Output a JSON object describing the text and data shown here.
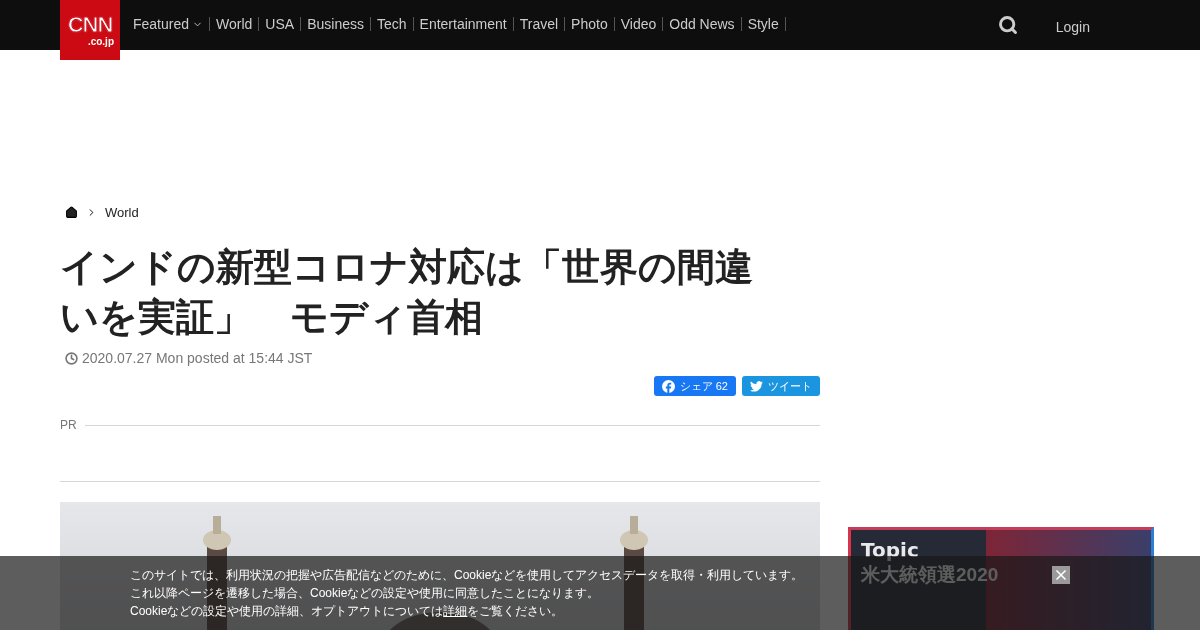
{
  "header": {
    "logo": {
      "main": "CNN",
      "sub": ".co.jp"
    },
    "nav": [
      {
        "label": "Featured",
        "dropdown": true
      },
      {
        "label": "World",
        "dropdown": false
      },
      {
        "label": "USA",
        "dropdown": false
      },
      {
        "label": "Business",
        "dropdown": false
      },
      {
        "label": "Tech",
        "dropdown": false
      },
      {
        "label": "Entertainment",
        "dropdown": false
      },
      {
        "label": "Travel",
        "dropdown": false
      },
      {
        "label": "Photo",
        "dropdown": false
      },
      {
        "label": "Video",
        "dropdown": false
      },
      {
        "label": "Odd News",
        "dropdown": false
      },
      {
        "label": "Style",
        "dropdown": false
      }
    ],
    "login": "Login"
  },
  "breadcrumb": [
    "World"
  ],
  "article": {
    "title": "インドの新型コロナ対応は「世界の間違いを実証」　モディ首相",
    "date": "2020.07.27 Mon posted at 15:44 JST",
    "share": [
      {
        "kind": "facebook",
        "label": "シェア",
        "count": "62"
      },
      {
        "kind": "twitter",
        "label": "ツイート"
      }
    ],
    "pr_label": "PR"
  },
  "sidebar": {
    "banner": {
      "title": "Topic",
      "subtitle": "米大統領選2020"
    }
  },
  "cookie_notice": {
    "lines": [
      "このサイトでは、利用状況の把握や広告配信などのために、Cookieなどを使用してアクセスデータを取得・利用しています。",
      "これ以降ページを遷移した場合、Cookieなどの設定や使用に同意したことになります。"
    ],
    "last_before": "Cookieなどの設定や使用の詳細、オプトアウトについては",
    "link": "詳細",
    "last_after": "をご覧ください。"
  }
}
